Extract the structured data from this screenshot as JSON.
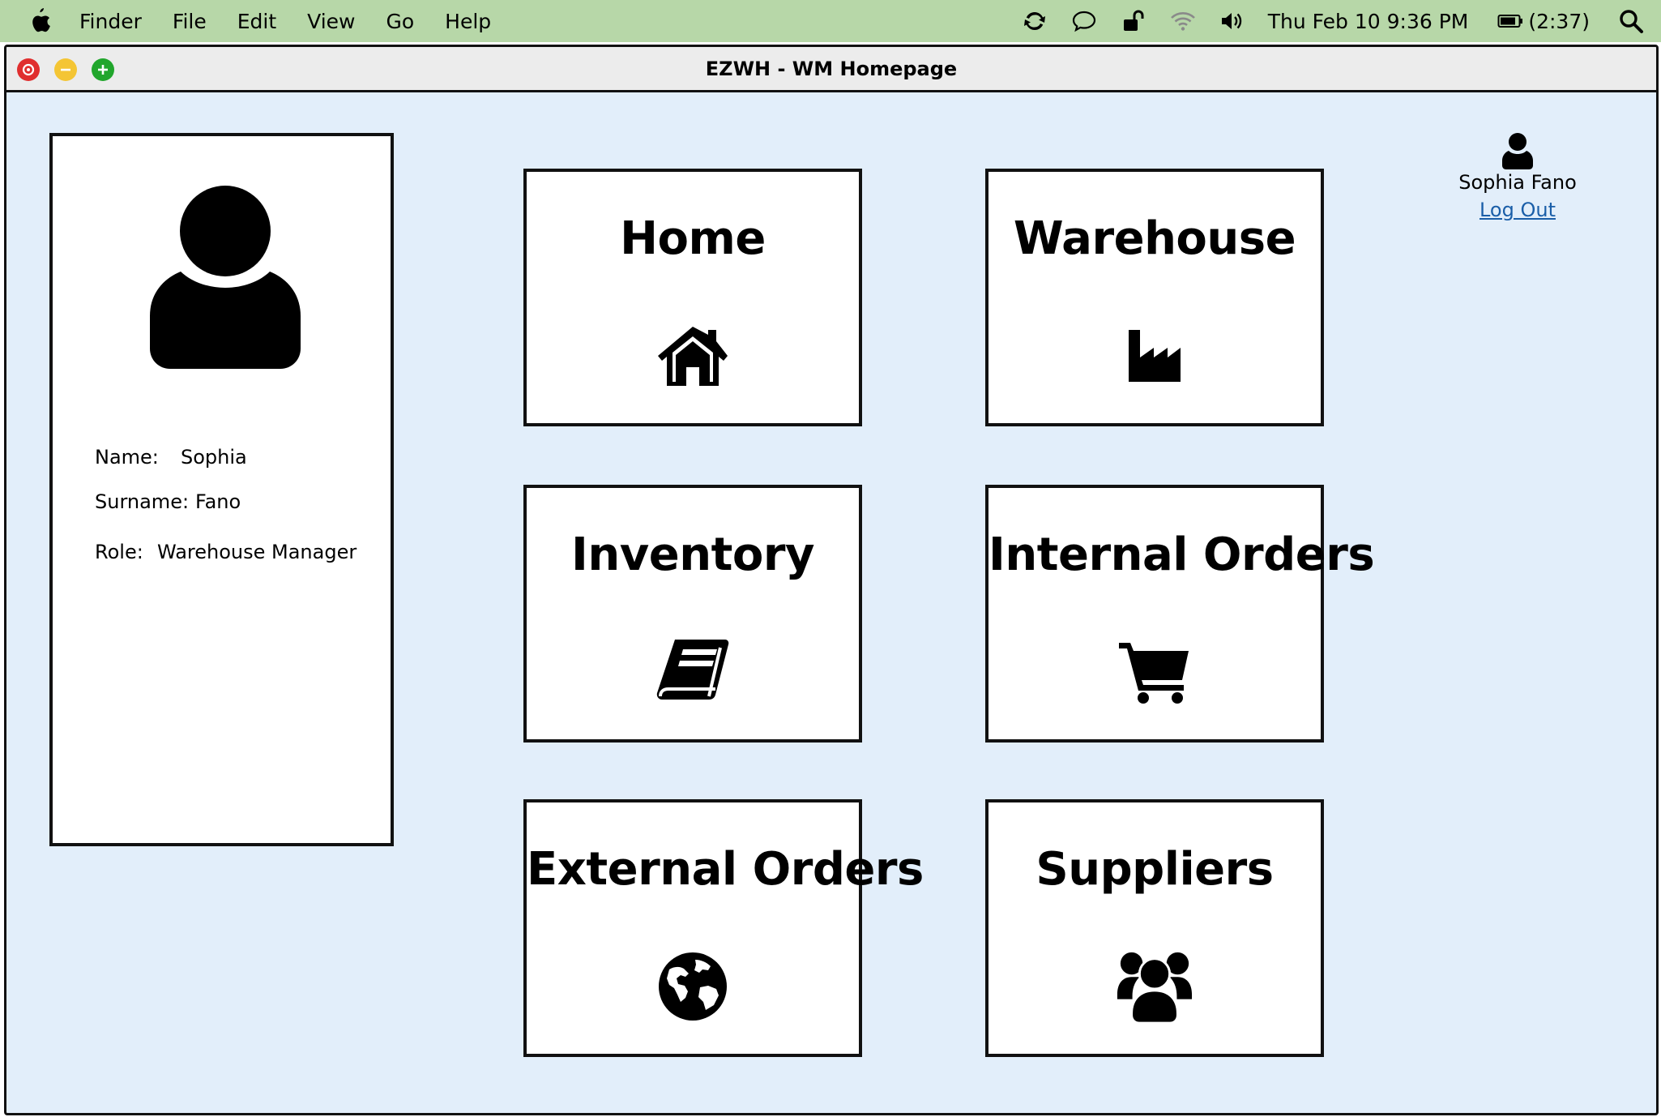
{
  "menubar": {
    "apple_icon": "apple-icon",
    "items": [
      "Finder",
      "File",
      "Edit",
      "View",
      "Go",
      "Help"
    ],
    "clock": "Thu Feb 10  9:36 PM",
    "battery": "(2:37)"
  },
  "window": {
    "title": "EZWH - WM Homepage"
  },
  "profile": {
    "name_label": "Name:",
    "name_value": "Sophia",
    "surname_label": "Surname:",
    "surname_value": "Fano",
    "role_label": "Role:",
    "role_value": "Warehouse Manager"
  },
  "tiles": [
    {
      "label": "Home",
      "icon": "home-icon"
    },
    {
      "label": "Warehouse",
      "icon": "factory-icon"
    },
    {
      "label": "Inventory",
      "icon": "book-icon"
    },
    {
      "label": "Internal Orders",
      "icon": "cart-icon"
    },
    {
      "label": "External Orders",
      "icon": "globe-icon"
    },
    {
      "label": "Suppliers",
      "icon": "users-icon"
    }
  ],
  "user": {
    "display_name": "Sophia Fano",
    "logout_label": "Log Out"
  }
}
